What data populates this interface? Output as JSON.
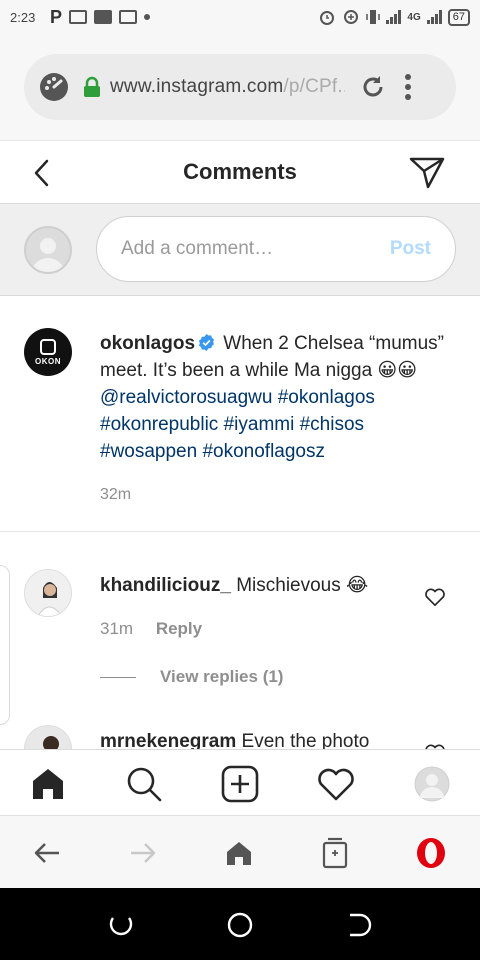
{
  "status_bar": {
    "time": "2:23",
    "network": "4G",
    "battery": "67"
  },
  "browser": {
    "url_main": "www.instagram.com",
    "url_dim": "/p/CPf..."
  },
  "header": {
    "title": "Comments"
  },
  "add_comment": {
    "placeholder": "Add a comment…",
    "post_label": "Post"
  },
  "caption": {
    "username": "okonlagos",
    "logo_text": "OKON",
    "text_part1": "When 2 Chelsea “mumus” meet. It’s been a while Ma nigga 😀😀",
    "mention": "@realvictorosuagwu",
    "hashtags": "#okonlagos #okonrepublic #iyammi #chisos #wosappen #okonoflagosz",
    "time": "32m"
  },
  "comments": [
    {
      "username": "khandiliciouz_",
      "text": "Mischievous 😂",
      "time": "31m",
      "reply_label": "Reply",
      "view_replies": "View replies (1)"
    },
    {
      "username": "mrnekenegram",
      "text": "Even the photo"
    }
  ],
  "icons": {
    "bottom_nav": [
      "home-icon",
      "search-icon",
      "new-post-icon",
      "activity-heart-icon",
      "profile-icon"
    ],
    "browser_bar": [
      "back-arrow-icon",
      "forward-arrow-icon",
      "browser-home-icon",
      "tabs-icon",
      "opera-icon"
    ]
  },
  "colors": {
    "link": "#003569",
    "post_disabled": "#b3dbff",
    "verified": "#3897f0",
    "opera_red": "#e0000f"
  }
}
